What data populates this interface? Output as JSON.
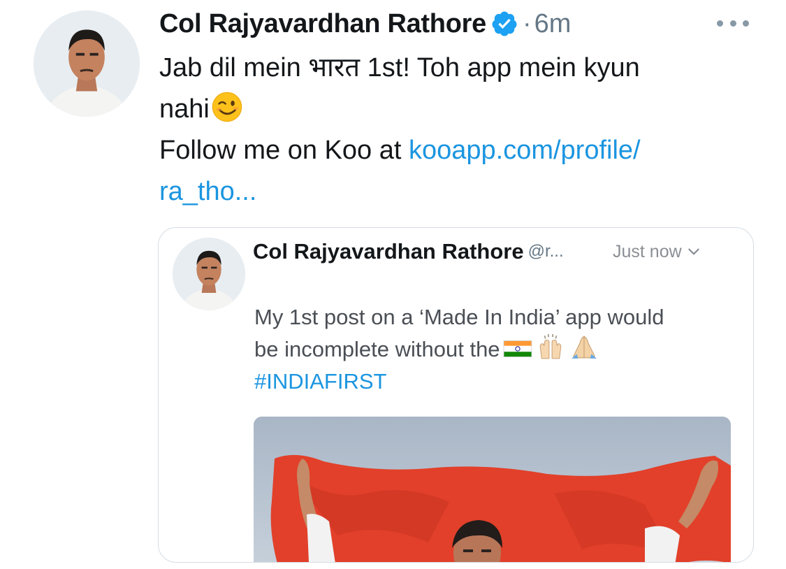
{
  "tweet": {
    "author_name": "Col Rajyavardhan Rathore",
    "verified": true,
    "separator": "·",
    "time": "6m",
    "text_line1": "Jab dil mein भारत 1st! Toh app mein kyun",
    "text_line2": "nahi",
    "text_line3_prefix": "Follow me on Koo at ",
    "link_part1": "kooapp.com/profile/",
    "link_part2": "ra_tho...",
    "emoji": "wink-face-icon"
  },
  "quoted_post": {
    "author_name": "Col Rajyavardhan Rathore",
    "handle": "@r...",
    "time": "Just now",
    "text_line1": "My 1st post on a ‘Made In India’ app would",
    "text_line2": "be incomplete without the",
    "hashtag": "#INDIAFIRST",
    "emojis": [
      "india-flag-icon",
      "raising-hands-icon",
      "folded-hands-icon"
    ]
  },
  "colors": {
    "link": "#1b95e0",
    "text": "#14171a",
    "muted": "#657786",
    "verified_badge": "#1da1f2",
    "flag_red": "#e2402a"
  }
}
